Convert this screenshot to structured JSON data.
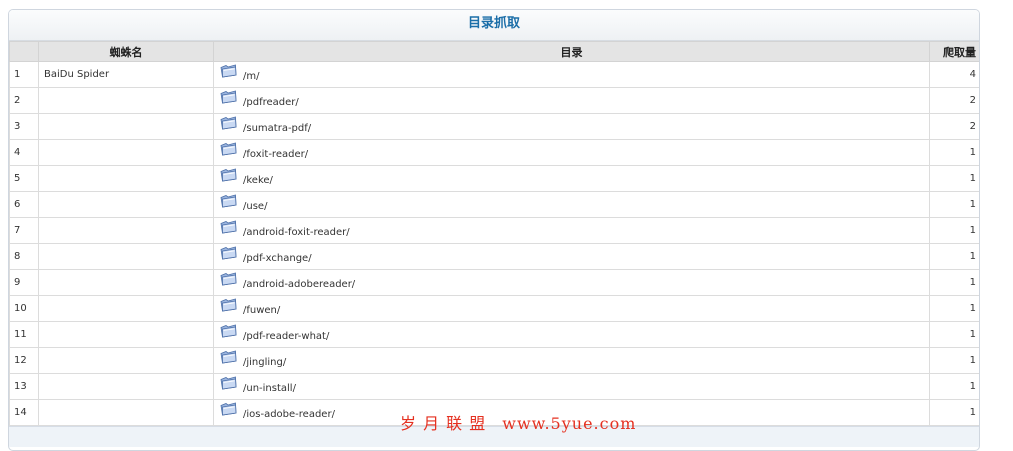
{
  "panel": {
    "title": "目录抓取"
  },
  "table": {
    "columns": [
      "",
      "蜘蛛名",
      "目录",
      "爬取量"
    ],
    "rows": [
      {
        "index": "1",
        "spider": "BaiDu Spider",
        "dir": "/m/",
        "count": "4"
      },
      {
        "index": "2",
        "spider": "",
        "dir": "/pdfreader/",
        "count": "2"
      },
      {
        "index": "3",
        "spider": "",
        "dir": "/sumatra-pdf/",
        "count": "2"
      },
      {
        "index": "4",
        "spider": "",
        "dir": "/foxit-reader/",
        "count": "1"
      },
      {
        "index": "5",
        "spider": "",
        "dir": "/keke/",
        "count": "1"
      },
      {
        "index": "6",
        "spider": "",
        "dir": "/use/",
        "count": "1"
      },
      {
        "index": "7",
        "spider": "",
        "dir": "/android-foxit-reader/",
        "count": "1"
      },
      {
        "index": "8",
        "spider": "",
        "dir": "/pdf-xchange/",
        "count": "1"
      },
      {
        "index": "9",
        "spider": "",
        "dir": "/android-adobereader/",
        "count": "1"
      },
      {
        "index": "10",
        "spider": "",
        "dir": "/fuwen/",
        "count": "1"
      },
      {
        "index": "11",
        "spider": "",
        "dir": "/pdf-reader-what/",
        "count": "1"
      },
      {
        "index": "12",
        "spider": "",
        "dir": "/jingling/",
        "count": "1"
      },
      {
        "index": "13",
        "spider": "",
        "dir": "/un-install/",
        "count": "1"
      },
      {
        "index": "14",
        "spider": "",
        "dir": "/ios-adobe-reader/",
        "count": "1"
      }
    ]
  },
  "row_icon": "folder-icon",
  "watermark": {
    "cn": "岁 月 联 盟",
    "url": "www.5yue.com"
  },
  "colors": {
    "title": "#1b6ea8",
    "watermark": "#e53020",
    "header_bg": "#e4e4e4"
  }
}
